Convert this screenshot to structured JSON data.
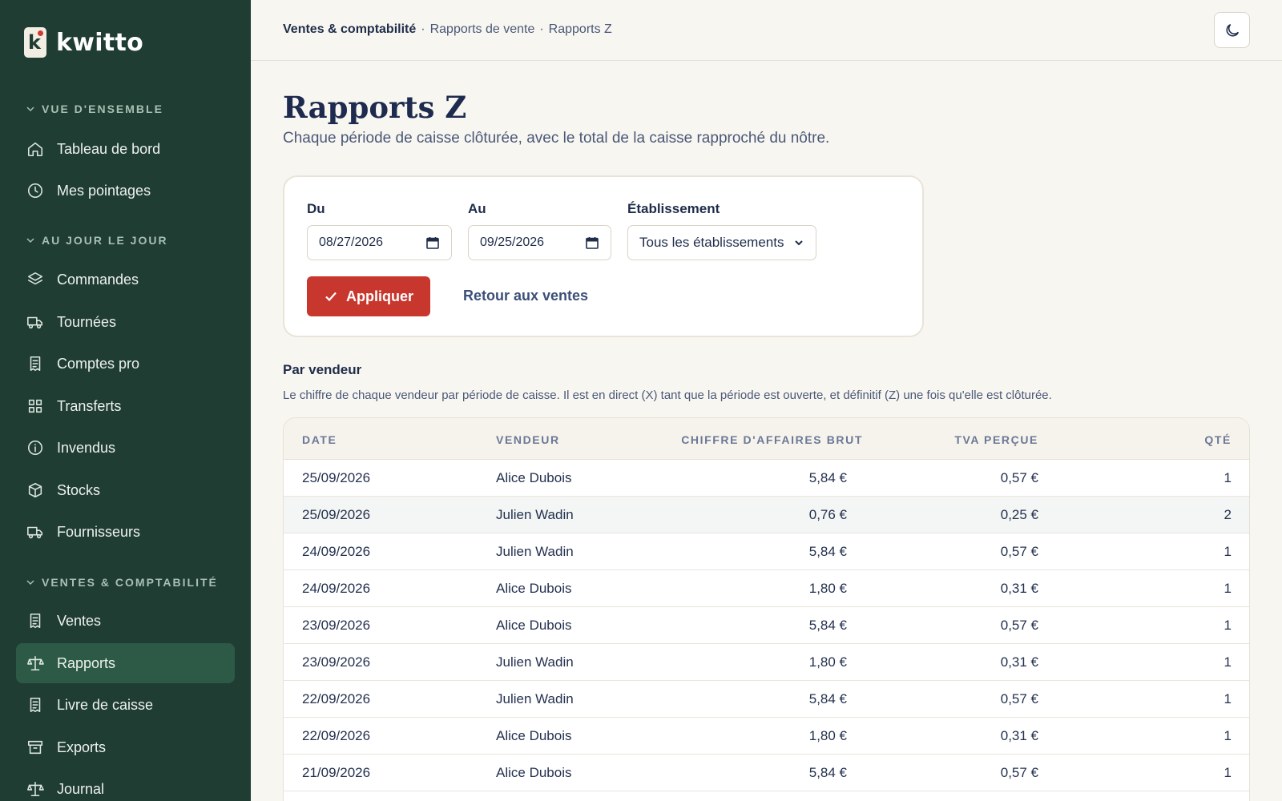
{
  "brand": {
    "name": "kwitto",
    "mark_letter": "k"
  },
  "sidebar": {
    "sections": [
      {
        "label": "VUE D'ENSEMBLE"
      },
      {
        "label": "AU JOUR LE JOUR"
      },
      {
        "label": "VENTES & COMPTABILITÉ"
      }
    ],
    "items": [
      {
        "label": "Tableau de bord",
        "icon": "home-icon"
      },
      {
        "label": "Mes pointages",
        "icon": "clock-icon"
      },
      {
        "label": "Commandes",
        "icon": "layers-icon"
      },
      {
        "label": "Tournées",
        "icon": "truck-icon"
      },
      {
        "label": "Comptes pro",
        "icon": "receipt-icon"
      },
      {
        "label": "Transferts",
        "icon": "grid-icon"
      },
      {
        "label": "Invendus",
        "icon": "info-icon"
      },
      {
        "label": "Stocks",
        "icon": "box-icon"
      },
      {
        "label": "Fournisseurs",
        "icon": "truck-icon"
      },
      {
        "label": "Ventes",
        "icon": "receipt-icon"
      },
      {
        "label": "Rapports",
        "icon": "scale-icon",
        "active": true
      },
      {
        "label": "Livre de caisse",
        "icon": "receipt-icon"
      },
      {
        "label": "Exports",
        "icon": "archive-icon"
      },
      {
        "label": "Journal",
        "icon": "scale-icon"
      }
    ]
  },
  "breadcrumb": {
    "items": [
      "Ventes & comptabilité",
      "Rapports de vente",
      "Rapports Z"
    ],
    "separator": "·"
  },
  "page": {
    "title": "Rapports Z",
    "subtitle": "Chaque période de caisse clôturée, avec le total de la caisse rapproché du nôtre."
  },
  "filters": {
    "from_label": "Du",
    "from_value": "08/27/2026",
    "to_label": "Au",
    "to_value": "09/25/2026",
    "site_label": "Établissement",
    "site_value": "Tous les établissements",
    "apply_label": "Appliquer",
    "back_label": "Retour aux ventes"
  },
  "by_seller": {
    "title": "Par vendeur",
    "description": "Le chiffre de chaque vendeur par période de caisse. Il est en direct (X) tant que la période est ouverte, et définitif (Z) une fois qu'elle est clôturée.",
    "columns": [
      "DATE",
      "VENDEUR",
      "CHIFFRE D'AFFAIRES BRUT",
      "TVA PERÇUE",
      "QTÉ"
    ],
    "rows": [
      {
        "date": "25/09/2026",
        "seller": "Alice Dubois",
        "gross": "5,84 €",
        "vat": "0,57 €",
        "qty": "1"
      },
      {
        "date": "25/09/2026",
        "seller": "Julien Wadin",
        "gross": "0,76 €",
        "vat": "0,25 €",
        "qty": "2"
      },
      {
        "date": "24/09/2026",
        "seller": "Julien Wadin",
        "gross": "5,84 €",
        "vat": "0,57 €",
        "qty": "1"
      },
      {
        "date": "24/09/2026",
        "seller": "Alice Dubois",
        "gross": "1,80 €",
        "vat": "0,31 €",
        "qty": "1"
      },
      {
        "date": "23/09/2026",
        "seller": "Alice Dubois",
        "gross": "5,84 €",
        "vat": "0,57 €",
        "qty": "1"
      },
      {
        "date": "23/09/2026",
        "seller": "Julien Wadin",
        "gross": "1,80 €",
        "vat": "0,31 €",
        "qty": "1"
      },
      {
        "date": "22/09/2026",
        "seller": "Julien Wadin",
        "gross": "5,84 €",
        "vat": "0,57 €",
        "qty": "1"
      },
      {
        "date": "22/09/2026",
        "seller": "Alice Dubois",
        "gross": "1,80 €",
        "vat": "0,31 €",
        "qty": "1"
      },
      {
        "date": "21/09/2026",
        "seller": "Alice Dubois",
        "gross": "5,84 €",
        "vat": "0,57 €",
        "qty": "1"
      }
    ]
  },
  "colors": {
    "sidebar_bg": "#1f3d33",
    "sidebar_active": "#2c5a47",
    "accent_red": "#c8372e",
    "page_bg": "#f8f6f0",
    "title": "#1e2b4f"
  }
}
